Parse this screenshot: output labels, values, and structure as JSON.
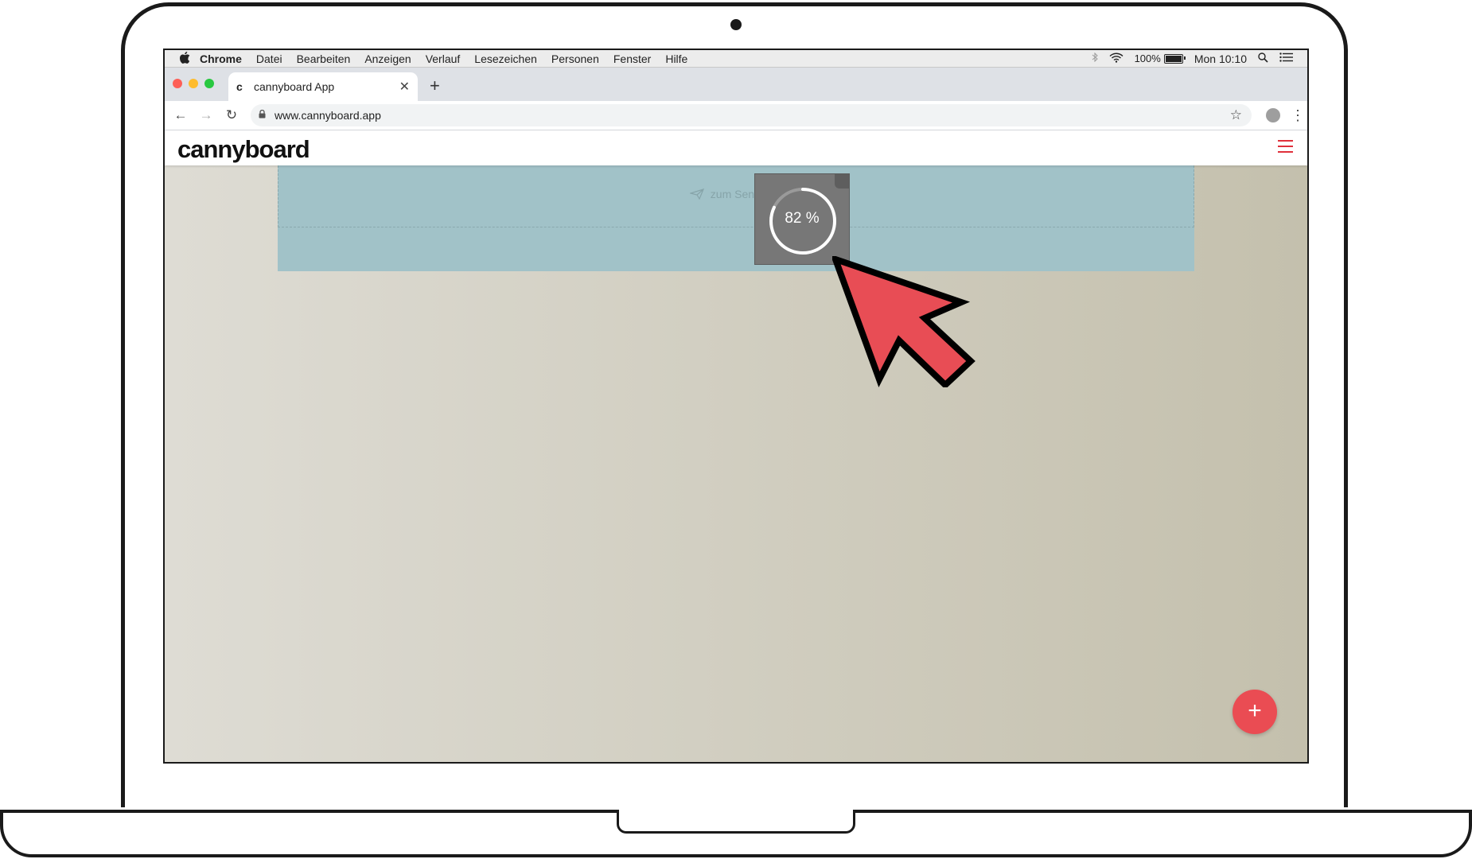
{
  "menubar": {
    "app": "Chrome",
    "items": [
      "Datei",
      "Bearbeiten",
      "Anzeigen",
      "Verlauf",
      "Lesezeichen",
      "Personen",
      "Fenster",
      "Hilfe"
    ],
    "battery": "100%",
    "clock": "Mon 10:10"
  },
  "browser": {
    "tab_title": "cannyboard App",
    "favicon": "c",
    "new_tab": "+",
    "url": "www.cannyboard.app"
  },
  "app": {
    "logo": "cannyboard"
  },
  "board": {
    "drop_hint": "zum Senden h",
    "upload_progress": 82,
    "upload_label": "82 %",
    "fab_label": "+"
  },
  "colors": {
    "accent": "#ea4c53",
    "drop_zone": "#a1c2c8"
  }
}
